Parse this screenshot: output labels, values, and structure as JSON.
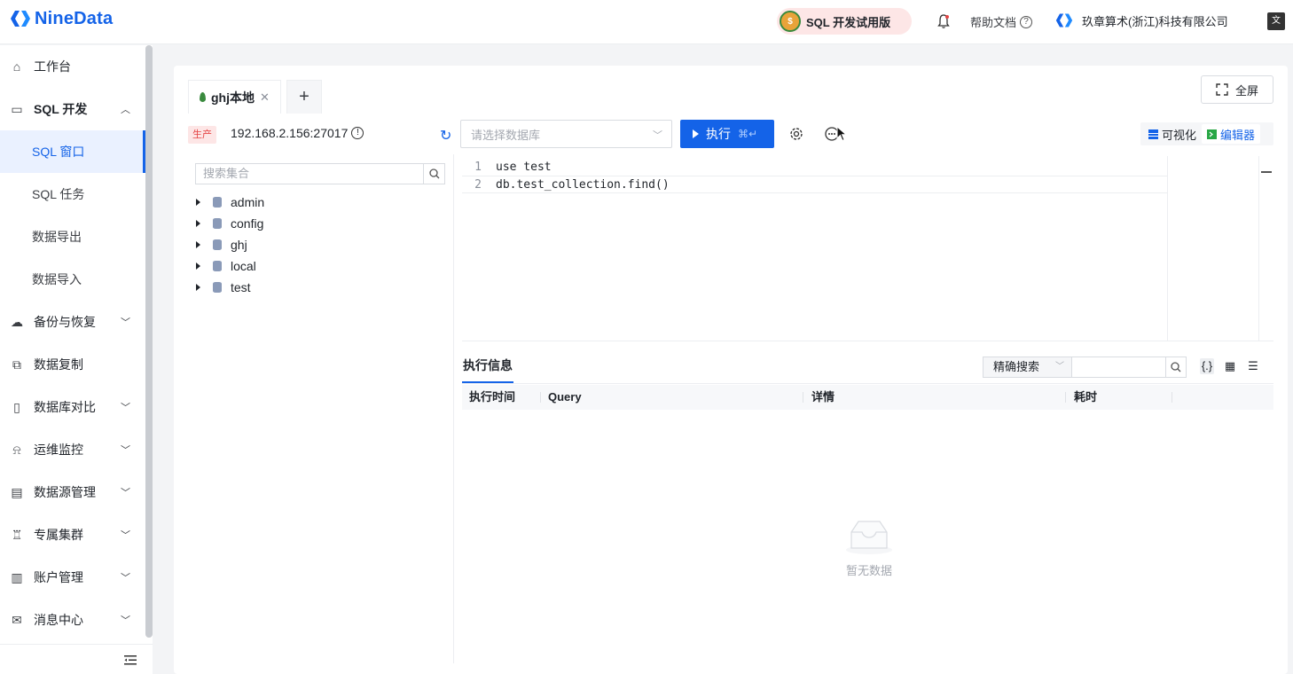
{
  "brand": {
    "name": "NineData",
    "color": "#1463e8"
  },
  "header": {
    "trial_badge": "SQL 开发试用版",
    "help": "帮助文档",
    "help_icon": "question-circle-icon",
    "org_name": "玖章算术(浙江)科技有限公司"
  },
  "sidebar": {
    "items": [
      {
        "label": "工作台",
        "icon": "home-icon"
      },
      {
        "label": "SQL 开发",
        "icon": "monitor-icon",
        "expanded": true
      },
      {
        "label": "SQL 窗口",
        "active": true
      },
      {
        "label": "SQL 任务"
      },
      {
        "label": "数据导出"
      },
      {
        "label": "数据导入"
      },
      {
        "label": "备份与恢复",
        "icon": "cloud-backup-icon"
      },
      {
        "label": "数据复制",
        "icon": "copy-icon"
      },
      {
        "label": "数据库对比",
        "icon": "compare-icon"
      },
      {
        "label": "运维监控",
        "icon": "alarm-icon"
      },
      {
        "label": "数据源管理",
        "icon": "datasource-icon"
      },
      {
        "label": "专属集群",
        "icon": "cluster-icon"
      },
      {
        "label": "账户管理",
        "icon": "account-icon"
      },
      {
        "label": "消息中心",
        "icon": "mail-icon"
      }
    ]
  },
  "workspace": {
    "tabs": [
      {
        "label": "ghj本地"
      }
    ],
    "add_tab": "+",
    "fullscreen": "全屏",
    "env_tag": "生产",
    "connection": "192.168.2.156:27017",
    "db_select_placeholder": "请选择数据库",
    "execute_label": "执行",
    "execute_shortcut": "⌘↵",
    "view_visual": "可视化",
    "view_editor": "编辑器"
  },
  "tree": {
    "search_placeholder": "搜索集合",
    "databases": [
      "admin",
      "config",
      "ghj",
      "local",
      "test"
    ]
  },
  "editor": {
    "lines": [
      {
        "no": "1",
        "code": "use test"
      },
      {
        "no": "2",
        "code": "db.test_collection.find()"
      }
    ]
  },
  "results": {
    "tab": "执行信息",
    "search_mode": "精确搜索",
    "columns": [
      "执行时间",
      "Query",
      "详情",
      "耗时"
    ],
    "empty_text": "暂无数据"
  }
}
